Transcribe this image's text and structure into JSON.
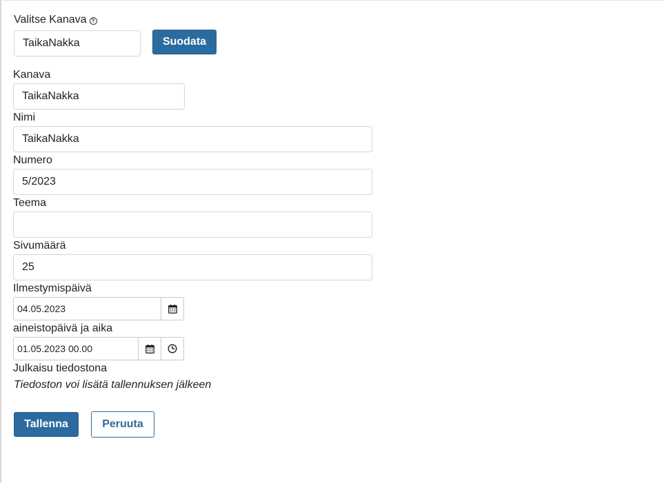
{
  "filter": {
    "label": "Valitse Kanava",
    "help_glyph": "?",
    "channel_value": "TaikaNakka",
    "filter_button": "Suodata"
  },
  "form": {
    "kanava": {
      "label": "Kanava",
      "value": "TaikaNakka"
    },
    "nimi": {
      "label": "Nimi",
      "value": "TaikaNakka"
    },
    "numero": {
      "label": "Numero",
      "value": "5/2023"
    },
    "teema": {
      "label": "Teema",
      "value": ""
    },
    "sivumaara": {
      "label": "Sivumäärä",
      "value": "25"
    },
    "ilmestymispaiva": {
      "label": "Ilmestymispäivä",
      "value": "04.05.2023"
    },
    "aineistopaiva": {
      "label": "aineistopäivä ja aika",
      "value": "01.05.2023 00.00"
    },
    "julkaisu": {
      "label": "Julkaisu tiedostona",
      "note": "Tiedoston voi lisätä tallennuksen jälkeen"
    }
  },
  "actions": {
    "save": "Tallenna",
    "cancel": "Peruuta"
  },
  "icons": {
    "calendar": "calendar-icon",
    "clock": "clock-icon",
    "help": "question-circle-icon"
  },
  "colors": {
    "primary": "#2c6ba0"
  }
}
